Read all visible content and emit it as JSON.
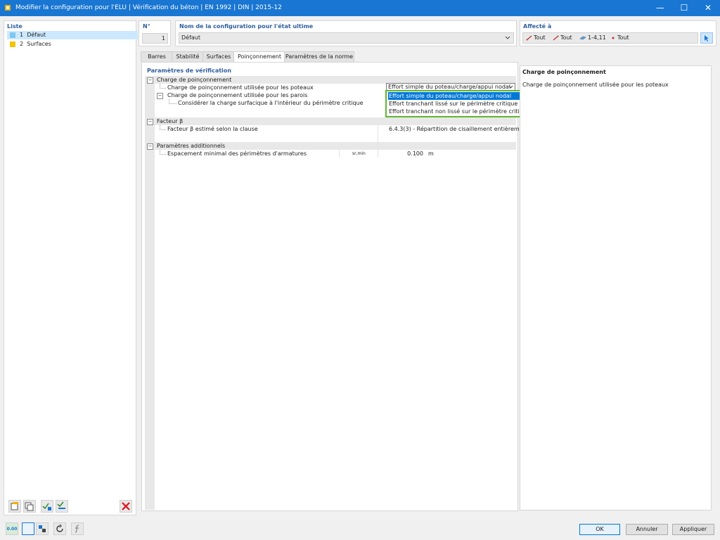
{
  "window": {
    "title": "Modifier la configuration pour l'ELU | Vérification du béton | EN 1992 | DIN | 2015-12",
    "minimize": "—",
    "maximize": "☐",
    "close": "✕"
  },
  "list": {
    "header": "Liste",
    "items": [
      {
        "num": "1",
        "label": "Défaut",
        "color": "#7ec8f0"
      },
      {
        "num": "2",
        "label": "Surfaces",
        "color": "#f5c400"
      }
    ]
  },
  "config": {
    "no_header": "N°",
    "no_value": "1",
    "name_header": "Nom de la configuration pour l'état ultime",
    "name_value": "Défaut"
  },
  "assigned": {
    "header": "Affecté à",
    "items": [
      "Tout",
      "Tout",
      "1-4,11",
      "Tout"
    ]
  },
  "tabs": [
    "Barres",
    "Stabilité",
    "Surfaces",
    "Poinçonnement",
    "Paramètres de la norme"
  ],
  "active_tab": "Poinçonnement",
  "params": {
    "title": "Paramètres de vérification",
    "sections": [
      {
        "label": "Charge de poinçonnement",
        "rows": [
          {
            "label": "Charge de poinçonnement utilisée pour les poteaux",
            "value": "Effort simple du poteau/charge/appui nodal"
          },
          {
            "label": "Charge de poinçonnement utilisée pour les parois"
          },
          {
            "label": "Considérer la charge surfacique à l'intérieur du périmètre critique"
          }
        ]
      },
      {
        "label": "Facteur β",
        "rows": [
          {
            "label": "Facteur β estimé selon la clause",
            "value": "6.4.3(3) - Répartition de cisaillement entièrem..."
          }
        ]
      },
      {
        "label": "Paramètres additionnels",
        "rows": [
          {
            "label": "Espacement minimal des périmètres d'armatures",
            "symbol": "sr,min",
            "value": "0.100",
            "unit": "m"
          }
        ]
      }
    ],
    "dropdown_options": [
      "Effort simple du poteau/charge/appui nodal",
      "Effort tranchant lissé sur le périmètre critique",
      "Effort tranchant non lissé sur le périmètre critique"
    ]
  },
  "info": {
    "title": "Charge de poinçonnement",
    "text": "Charge de poinçonnement utilisée pour les poteaux"
  },
  "buttons": {
    "ok": "OK",
    "cancel": "Annuler",
    "apply": "Appliquer"
  },
  "bottom_tool_label": "0.00",
  "colors": {
    "titlebar": "#1976d2",
    "selection": "#0078d7",
    "highlight_border": "#5cb82e",
    "list_selected": "#cce8ff",
    "delete": "#e0101a"
  }
}
